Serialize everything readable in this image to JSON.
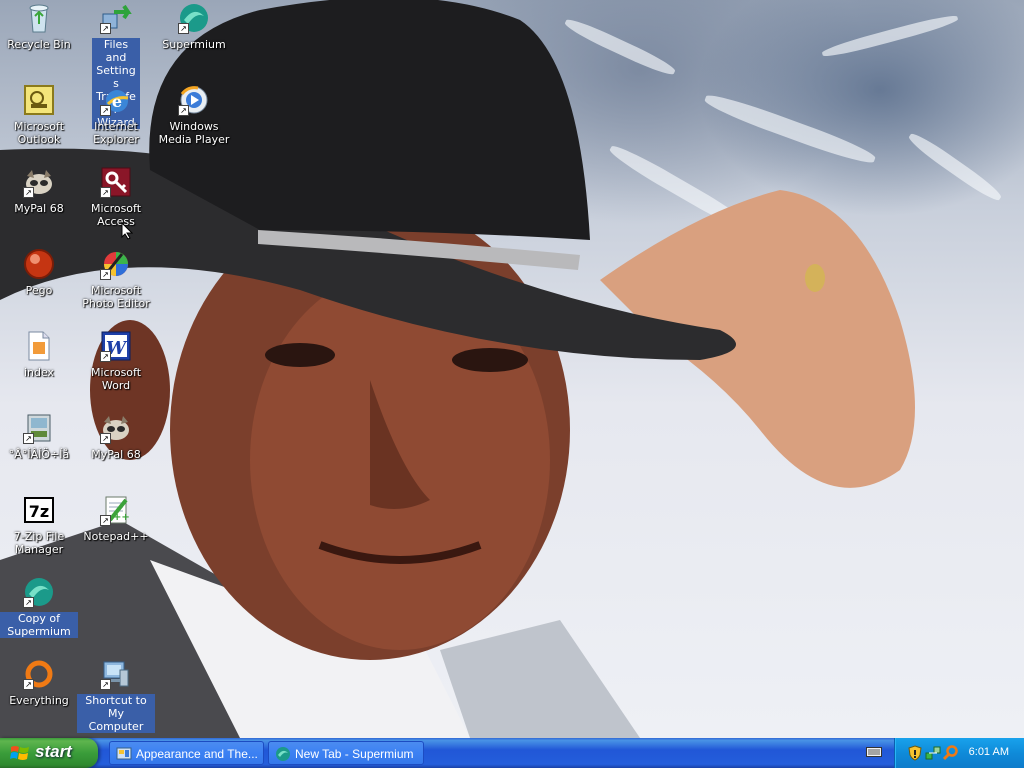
{
  "desktop": {
    "icons": [
      {
        "label": "Recycle Bin"
      },
      {
        "label": "Files and Settings Transfer Wizard"
      },
      {
        "label": "Supermium"
      },
      {
        "label": "Microsoft Outlook"
      },
      {
        "label": "Internet Explorer"
      },
      {
        "label": "Windows Media Player"
      },
      {
        "label": "MyPal 68"
      },
      {
        "label": "Microsoft Access"
      },
      {
        "label": "Pego"
      },
      {
        "label": "Microsoft Photo Editor"
      },
      {
        "label": "index"
      },
      {
        "label": "Microsoft Word"
      },
      {
        "label": "°Å°ÍÂÍÖ÷Íå"
      },
      {
        "label": "MyPal 68"
      },
      {
        "label": "7-Zip File Manager"
      },
      {
        "label": "Notepad++"
      },
      {
        "label": "Copy of Supermium"
      },
      {
        "label": "Everything"
      },
      {
        "label": "Shortcut to My Computer"
      }
    ]
  },
  "taskbar": {
    "start_label": "start",
    "tasks": [
      {
        "label": "Appearance and The..."
      },
      {
        "label": "New Tab - Supermium"
      }
    ],
    "clock": "6:01 AM"
  },
  "colors": {
    "taskbar_blue": "#245edb",
    "start_green": "#3a9d3a",
    "tray_blue": "#0f8bd9",
    "selection": "#3a5fa8"
  }
}
